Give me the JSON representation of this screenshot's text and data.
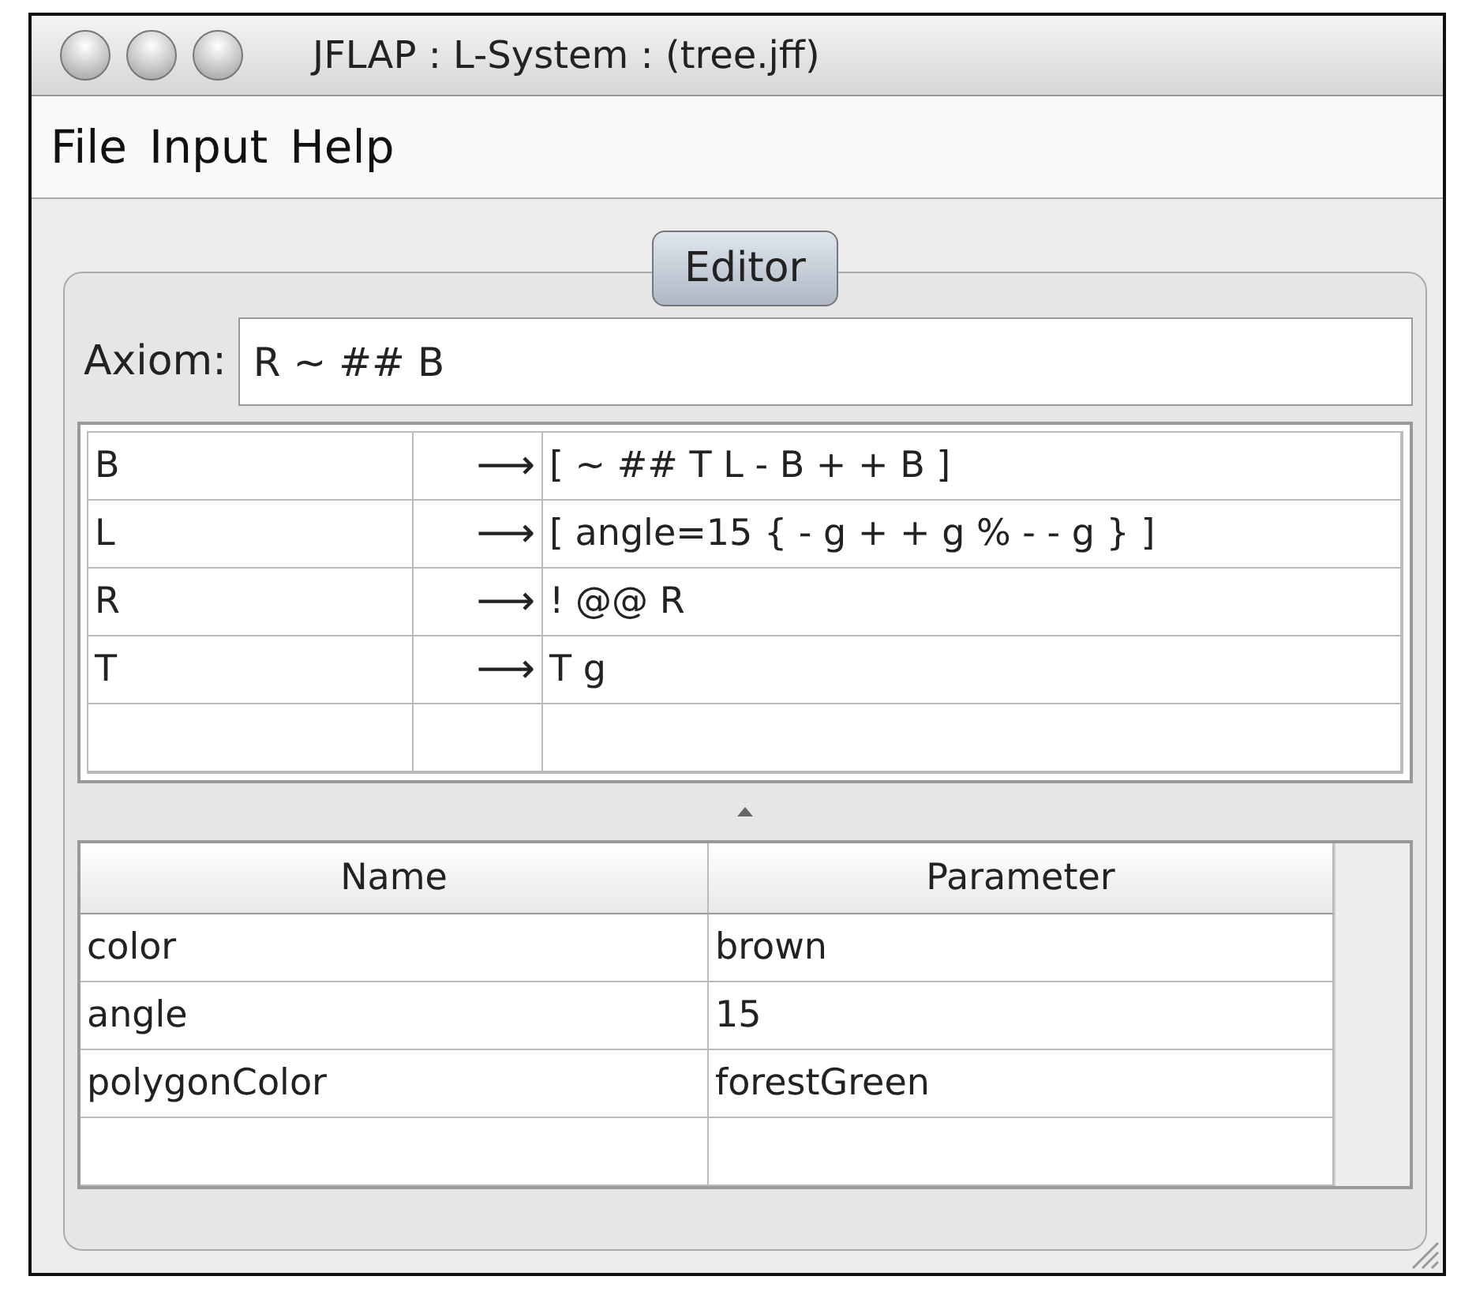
{
  "window": {
    "title": "JFLAP : L-System : (tree.jff)"
  },
  "menu": [
    "File",
    "Input",
    "Help"
  ],
  "tabs": [
    {
      "label": "Editor",
      "selected": true
    }
  ],
  "axiom": {
    "label": "Axiom:",
    "value": "R ~ ## B"
  },
  "rules": [
    {
      "symbol": "B",
      "arrow": "⟶",
      "replacement": "[ ~ ## T L - B + + B ]"
    },
    {
      "symbol": "L",
      "arrow": "⟶",
      "replacement": "[ angle=15 { - g + + g % - - g } ]"
    },
    {
      "symbol": "R",
      "arrow": "⟶",
      "replacement": "! @@ R"
    },
    {
      "symbol": "T",
      "arrow": "⟶",
      "replacement": "T g"
    }
  ],
  "parameters": {
    "columns": [
      "Name",
      "Parameter"
    ],
    "rows": [
      [
        "color",
        "brown"
      ],
      [
        "angle",
        "15"
      ],
      [
        "polygonColor",
        "forestGreen"
      ]
    ]
  }
}
